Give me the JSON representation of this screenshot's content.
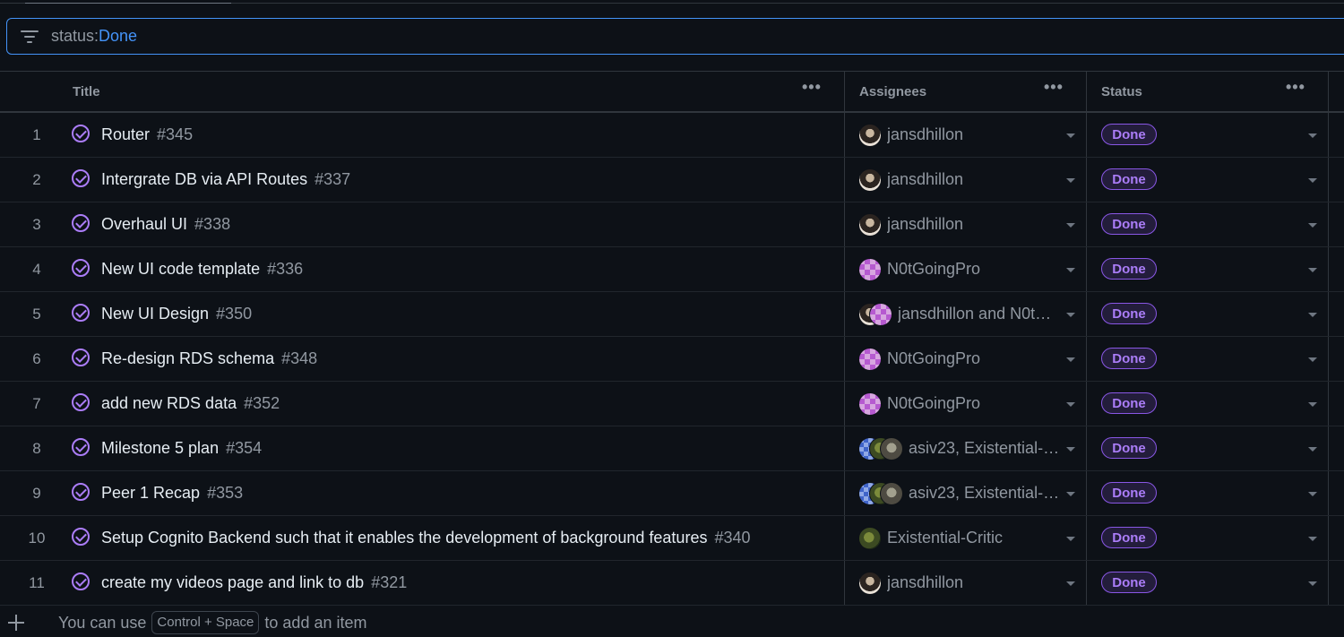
{
  "filter": {
    "key": "status:",
    "value": "Done"
  },
  "columns": {
    "title": "Title",
    "assignees": "Assignees",
    "status": "Status",
    "menu": "•••"
  },
  "rows": [
    {
      "num": "1",
      "title": "Router",
      "issue": "#345",
      "assignee": "jansdhillon",
      "avatars": [
        "jd"
      ],
      "status": "Done"
    },
    {
      "num": "2",
      "title": "Intergrate DB via API Routes",
      "issue": "#337",
      "assignee": "jansdhillon",
      "avatars": [
        "jd"
      ],
      "status": "Done"
    },
    {
      "num": "3",
      "title": "Overhaul UI",
      "issue": "#338",
      "assignee": "jansdhillon",
      "avatars": [
        "jd"
      ],
      "status": "Done"
    },
    {
      "num": "4",
      "title": "New UI code template",
      "issue": "#336",
      "assignee": "N0tGoingPro",
      "avatars": [
        "np"
      ],
      "status": "Done"
    },
    {
      "num": "5",
      "title": "New UI Design",
      "issue": "#350",
      "assignee": "jansdhillon and N0t…",
      "avatars": [
        "jd",
        "np"
      ],
      "status": "Done"
    },
    {
      "num": "6",
      "title": "Re-design RDS schema",
      "issue": "#348",
      "assignee": "N0tGoingPro",
      "avatars": [
        "np"
      ],
      "status": "Done"
    },
    {
      "num": "7",
      "title": "add new RDS data",
      "issue": "#352",
      "assignee": "N0tGoingPro",
      "avatars": [
        "np"
      ],
      "status": "Done"
    },
    {
      "num": "8",
      "title": "Milestone 5 plan",
      "issue": "#354",
      "assignee": "asiv23, Existential-…",
      "avatars": [
        "as",
        "ec",
        "x"
      ],
      "status": "Done"
    },
    {
      "num": "9",
      "title": "Peer 1 Recap",
      "issue": "#353",
      "assignee": "asiv23, Existential-…",
      "avatars": [
        "as",
        "ec",
        "x"
      ],
      "status": "Done"
    },
    {
      "num": "10",
      "title": "Setup Cognito Backend such that it enables the development of background features",
      "issue": "#340",
      "assignee": "Existential-Critic",
      "avatars": [
        "ec"
      ],
      "status": "Done"
    },
    {
      "num": "11",
      "title": "create my videos page and link to db",
      "issue": "#321",
      "assignee": "jansdhillon",
      "avatars": [
        "jd"
      ],
      "status": "Done"
    }
  ],
  "footer": {
    "before": "You can use",
    "kbd": "Control + Space",
    "after": "to add an item"
  },
  "colors": {
    "accent": "#4493f8",
    "done": "#ab7df8",
    "background": "#0d1117"
  }
}
